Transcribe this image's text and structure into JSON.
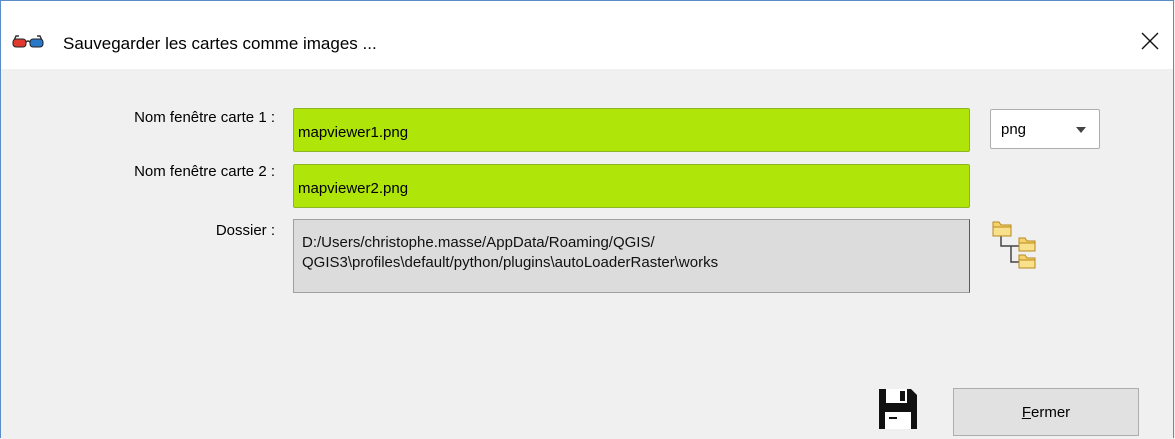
{
  "window": {
    "title": "Sauvegarder les cartes comme images ..."
  },
  "form": {
    "map1_label": "Nom fenêtre carte 1 :",
    "map1_value": "mapviewer1.png",
    "map2_label": "Nom fenêtre carte 2 :",
    "map2_value": "mapviewer2.png",
    "folder_label": "Dossier :",
    "folder_line1": "D:/Users/christophe.masse/AppData/Roaming/QGIS/",
    "folder_line2": "QGIS3\\profiles\\default/python/plugins\\autoLoaderRaster\\works",
    "format_value": "png"
  },
  "buttons": {
    "close_mnemonic": "F",
    "close_rest": "ermer"
  },
  "colors": {
    "field_valid": "#b0e50a",
    "field_readonly": "#dcdcdc",
    "window_border": "#5b8cc7"
  },
  "icons": {
    "title": "glasses-icon",
    "close": "close-icon",
    "folder": "folder-tree-icon",
    "save": "floppy-disk-icon",
    "dropdown": "chevron-down-icon"
  }
}
